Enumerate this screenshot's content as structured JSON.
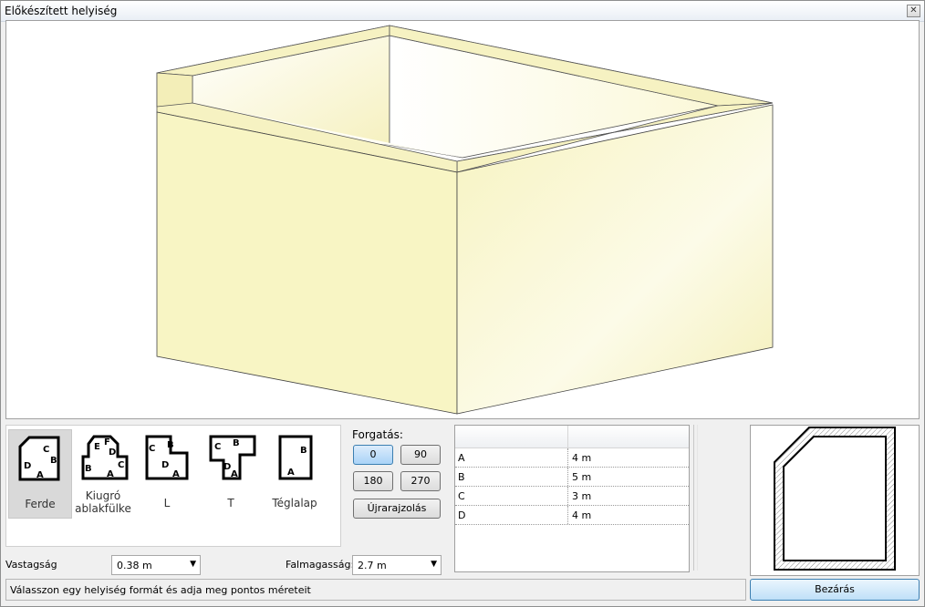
{
  "window": {
    "title": "Előkészített helyiség",
    "close_icon": "close-icon"
  },
  "shapes": [
    {
      "id": "ferde",
      "label": "Ferde",
      "selected": true
    },
    {
      "id": "kiugro",
      "label_line1": "Kiugró",
      "label_line2": "ablakfülke",
      "selected": false
    },
    {
      "id": "l",
      "label": "L",
      "selected": false
    },
    {
      "id": "t",
      "label": "T",
      "selected": false
    },
    {
      "id": "teglalap",
      "label": "Téglalap",
      "selected": false
    }
  ],
  "shape_letters": {
    "ferde": [
      "C",
      "B",
      "D",
      "A"
    ],
    "kiugro": [
      "E",
      "F",
      "D",
      "C",
      "B",
      "A"
    ],
    "l": [
      "B",
      "C",
      "D",
      "A"
    ],
    "t": [
      "C",
      "B",
      "D",
      "A"
    ],
    "teglalap": [
      "B",
      "A"
    ]
  },
  "rotation": {
    "label": "Forgatás:",
    "options": [
      "0",
      "90",
      "180",
      "270"
    ],
    "selected": "0",
    "redraw_label": "Újrarajzolás"
  },
  "dimensions": [
    {
      "name": "A",
      "value": "4 m"
    },
    {
      "name": "B",
      "value": "5 m"
    },
    {
      "name": "C",
      "value": "3 m"
    },
    {
      "name": "D",
      "value": "4 m"
    }
  ],
  "thickness": {
    "label": "Vastagság",
    "value": "0.38 m"
  },
  "wall_height": {
    "label": "Falmagasság:",
    "value": "2.7 m"
  },
  "status_text": "Válasszon egy helyiség formát és adja meg pontos méreteit",
  "close_button": "Bezárás",
  "colors": {
    "wall": "#f8f5c4",
    "accent": "#3c7fb1"
  }
}
